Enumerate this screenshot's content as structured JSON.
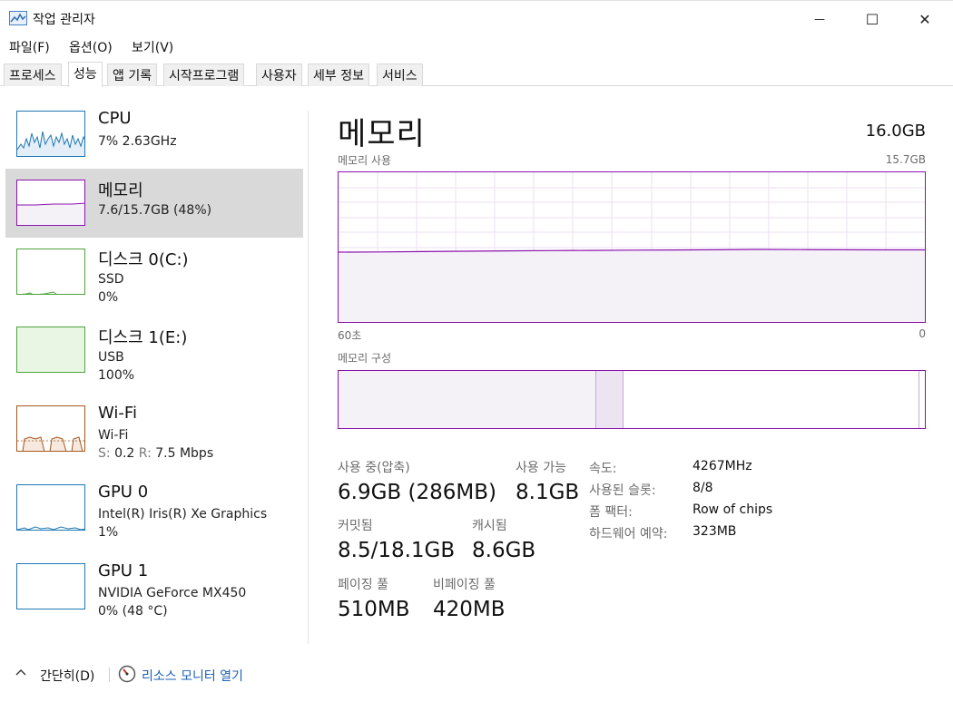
{
  "window": {
    "title": "작업 관리자",
    "minimize_glyph": "—",
    "maximize_glyph": "☐",
    "close_glyph": "✕",
    "title_icon": "task-manager-icon"
  },
  "menu": [
    {
      "label": "파일(F)"
    },
    {
      "label": "옵션(O)"
    },
    {
      "label": "보기(V)"
    }
  ],
  "tabs": [
    {
      "label": "프로세스"
    },
    {
      "label": "성능",
      "active": true
    },
    {
      "label": "앱 기록"
    },
    {
      "label": "시작프로그램"
    },
    {
      "label": "사용자"
    },
    {
      "label": "세부 정보"
    },
    {
      "label": "서비스"
    }
  ],
  "sidebar": {
    "items": [
      {
        "name": "CPU",
        "line1": "7% 2.63GHz",
        "line2": "",
        "color": "#1f77b4",
        "selected": false
      },
      {
        "name": "메모리",
        "line1": "7.6/15.7GB (48%)",
        "line2": "",
        "color": "#8b12ae",
        "selected": true
      },
      {
        "name": "디스크 0(C:)",
        "line1": "SSD",
        "line2": "0%",
        "color": "#4da43b",
        "selected": false
      },
      {
        "name": "디스크 1(E:)",
        "line1": "USB",
        "line2": "100%",
        "color": "#4da43b",
        "selected": false
      },
      {
        "name": "Wi-Fi",
        "line1": "Wi-Fi",
        "line2_parts": {
          "s_label": "S:",
          "s_value": "0.2",
          "r_label": "R:",
          "r_value": "7.5 Mbps"
        },
        "color": "#a7561b",
        "selected": false
      },
      {
        "name": "GPU 0",
        "line1": "Intel(R) Iris(R) Xe Graphics",
        "line2": "1%",
        "color": "#1f77b4",
        "selected": false
      },
      {
        "name": "GPU 1",
        "line1": "NVIDIA GeForce MX450",
        "line2": "0% (48 °C)",
        "color": "#1f77b4",
        "selected": false
      }
    ]
  },
  "main": {
    "title": "메모리",
    "total": "16.0GB",
    "usage_label": "메모리 사용",
    "usage_max": "15.7GB",
    "time_left": "60초",
    "time_right": "0",
    "composition_label": "메모리 구성",
    "usage_level": 0.48,
    "stats": {
      "in_use_label": "사용 중(압축)",
      "in_use_value": "6.9GB (286MB)",
      "available_label": "사용 가능",
      "available_value": "8.1GB",
      "committed_label": "커밋됨",
      "committed_value": "8.5/18.1GB",
      "cached_label": "캐시됨",
      "cached_value": "8.6GB",
      "paged_label": "페이징 풀",
      "paged_value": "510MB",
      "nonpaged_label": "비페이징 풀",
      "nonpaged_value": "420MB"
    },
    "specs": [
      {
        "label": "속도:",
        "value": "4267MHz"
      },
      {
        "label": "사용된 슬롯:",
        "value": "8/8"
      },
      {
        "label": "폼 팩터:",
        "value": "Row of chips"
      },
      {
        "label": "하드웨어 예약:",
        "value": "323MB"
      }
    ]
  },
  "footer": {
    "collapse_label": "간단히(D)",
    "resource_monitor_label": "리소스 모니터 열기"
  },
  "colors": {
    "memory_accent": "#8b12ae",
    "memory_fill": "#f4f2f7",
    "memory_modified": "#ede4f2",
    "link": "#1a5fb4"
  }
}
